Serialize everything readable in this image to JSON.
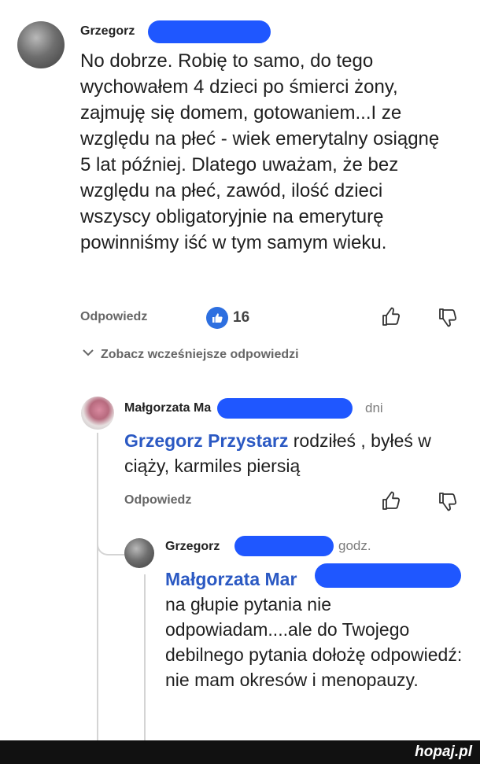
{
  "comment": {
    "author": "Grzegorz",
    "text": "No dobrze.  Robię to samo,  do tego wychowałem 4 dzieci po śmierci żony, zajmuję się domem,  gotowaniem...I ze względu na płeć  - wiek emerytalny osiągnę 5 lat później.  Dlatego uważam, że bez względu na płeć,  zawód,  ilość dzieci wszyscy obligatoryjnie na emeryturę powinniśmy iść w tym samym wieku.",
    "reply_label": "Odpowiedz",
    "like_count": "16"
  },
  "earlier_replies_label": "Zobacz wcześniejsze odpowiedzi",
  "reply1": {
    "author": "Małgorzata Ma",
    "time": "dni",
    "mention": "Grzegorz Przystarz",
    "text": " rodziłeś , byłeś w ciąży, karmiles piersią",
    "reply_label": "Odpowiedz"
  },
  "reply2": {
    "author": "Grzegorz",
    "time": "godz.",
    "mention": "Małgorzata Mar",
    "text": "na głupie pytania nie odpowiadam....ale do Twojego debilnego pytania dołożę odpowiedź: nie mam okresów i menopauzy."
  },
  "watermark": "hopaj.pl",
  "colors": {
    "redaction": "#1f57ff",
    "mention": "#2b59c3",
    "like_badge": "#2d6fe0"
  },
  "icons": [
    "like-badge-icon",
    "thumbs-up-icon",
    "thumbs-down-icon",
    "chevron-down-icon"
  ]
}
